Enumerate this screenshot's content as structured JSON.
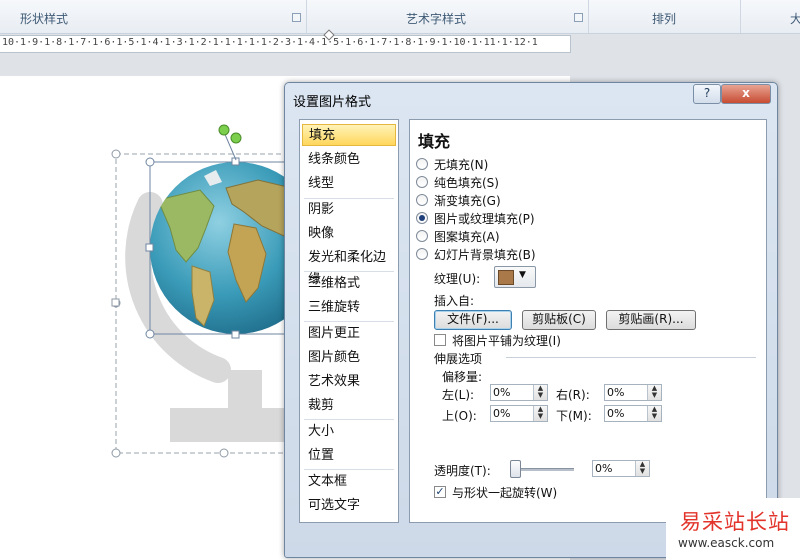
{
  "ribbon": {
    "groups": [
      {
        "label": "形状样式"
      },
      {
        "label": "艺术字样式"
      },
      {
        "label": "排列"
      },
      {
        "label": "大"
      }
    ]
  },
  "ruler": {
    "text": "10·1·9·1·8·1·7·1·6·1·5·1·4·1·3·1·2·1·1·1·1·1·2·3·1·4·1·5·1·6·1·7·1·8·1·9·1·10·1·11·1·12·1"
  },
  "dialog": {
    "title": "设置图片格式",
    "help_label": "?",
    "close_label": "x",
    "nav": [
      {
        "label": "填充"
      },
      {
        "label": "线条颜色"
      },
      {
        "label": "线型"
      },
      {
        "label": "阴影"
      },
      {
        "label": "映像"
      },
      {
        "label": "发光和柔化边缘"
      },
      {
        "label": "三维格式"
      },
      {
        "label": "三维旋转"
      },
      {
        "label": "图片更正"
      },
      {
        "label": "图片颜色"
      },
      {
        "label": "艺术效果"
      },
      {
        "label": "裁剪"
      },
      {
        "label": "大小"
      },
      {
        "label": "位置"
      },
      {
        "label": "文本框"
      },
      {
        "label": "可选文字"
      }
    ],
    "panel": {
      "title": "填充",
      "fill_options": [
        {
          "label": "无填充(N)",
          "selected": false
        },
        {
          "label": "纯色填充(S)",
          "selected": false
        },
        {
          "label": "渐变填充(G)",
          "selected": false
        },
        {
          "label": "图片或纹理填充(P)",
          "selected": true
        },
        {
          "label": "图案填充(A)",
          "selected": false
        },
        {
          "label": "幻灯片背景填充(B)",
          "selected": false
        }
      ],
      "texture_label": "纹理(U):",
      "insert_from_label": "插入自:",
      "file_button": "文件(F)...",
      "clipboard_button": "剪贴板(C)",
      "clipart_button": "剪贴画(R)...",
      "tile_label": "将图片平铺为纹理(I)",
      "tile_checked": false,
      "stretch_label": "伸展选项",
      "offset_label": "偏移量:",
      "offsets": [
        {
          "label": "左(L):",
          "value": "0%"
        },
        {
          "label": "右(R):",
          "value": "0%"
        },
        {
          "label": "上(O):",
          "value": "0%"
        },
        {
          "label": "下(M):",
          "value": "0%"
        }
      ],
      "transparency_label": "透明度(T):",
      "transparency_value": "0%",
      "transparency_level": 0,
      "rotate_label": "与形状一起旋转(W)",
      "rotate_checked": true
    }
  },
  "watermark": {
    "text": "易采站长站",
    "url": "www.easck.com"
  },
  "colors": {
    "ribbon_text": "#3f5a75",
    "nav_selected": "#ffd65c",
    "dialog_bg": "#d5e0ec",
    "close_button": "#c74c32",
    "watermark_red": "#e2342b"
  }
}
